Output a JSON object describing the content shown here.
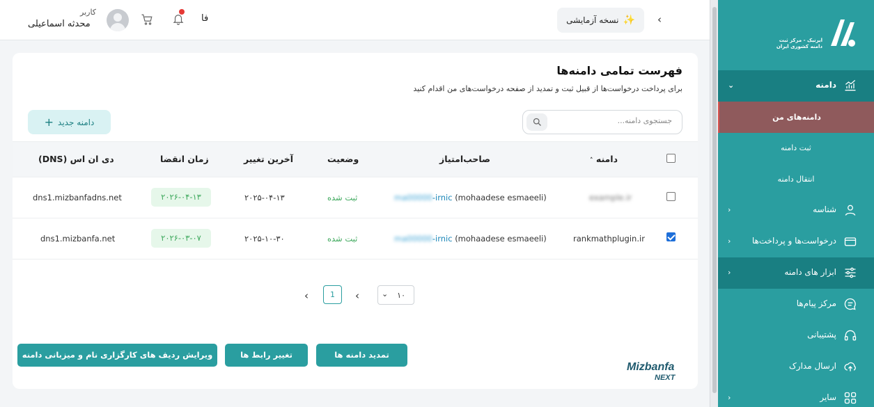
{
  "topbar": {
    "user_role": "کاربر",
    "user_name": "محدثه اسماعیلی",
    "language": "فا",
    "trial_label": "نسخه آزمایشی",
    "trial_icon": "sparkle-icon",
    "collapse_icon": "chevron-left-icon"
  },
  "sidebar": {
    "logo_text_line1": "ایرنیک - مرکز ثبت",
    "logo_text_line2": "دامنه کشوری ایران",
    "items": [
      {
        "label": "دامنه",
        "icon": "chart-icon",
        "expanded": true
      },
      {
        "label": "شناسه",
        "icon": "user-icon"
      },
      {
        "label": "درخواست‌ها و پرداخت‌ها",
        "icon": "card-icon"
      },
      {
        "label": "ابزار های دامنه",
        "icon": "sliders-icon"
      },
      {
        "label": "مرکز پیام‌ها",
        "icon": "message-icon"
      },
      {
        "label": "پشتیبانی",
        "icon": "headset-icon"
      },
      {
        "label": "ارسال مدارک",
        "icon": "upload-icon"
      },
      {
        "label": "سایر",
        "icon": "grid-icon"
      }
    ],
    "subitems": [
      {
        "label": "دامنه‌های من",
        "active": true
      },
      {
        "label": "ثبت دامنه"
      },
      {
        "label": "انتقال دامنه"
      }
    ]
  },
  "page": {
    "title": "فهرست تمامی دامنه‌ها",
    "subtitle": "برای پرداخت درخواست‌ها از قبیل ثبت و تمدید از صفحه درخواست‌های من اقدام کنید",
    "search_placeholder": "جستجوی دامنه...",
    "new_domain_label": "دامنه جدید"
  },
  "table": {
    "headers": {
      "domain": "دامنه",
      "owner": "صاحب‌امتیاز",
      "status": "وضعیت",
      "last_change": "آخرین تغییر",
      "expiry": "زمان انقضا",
      "dns": "دی ان اس (DNS)"
    },
    "rows": [
      {
        "checked": false,
        "domain": "example.ir",
        "owner_handle": "ma00000",
        "owner_suffix": "-irnic",
        "owner_name": "(mohaadese esmaeeli)",
        "status": "ثبت شده",
        "last_change": "۲۰۲۵-۰۴-۱۳",
        "expiry": "۲۰۲۶-۰۴-۱۳",
        "dns": "dns1.mizbanfadns.net"
      },
      {
        "checked": true,
        "domain": "rankmathplugin.ir",
        "owner_handle": "ma00000",
        "owner_suffix": "-irnic",
        "owner_name": "(mohaadese esmaeeli)",
        "status": "ثبت شده",
        "last_change": "۲۰۲۵-۱۰-۳۰",
        "expiry": "۲۰۲۶-۰۳-۰۷",
        "dns": "dns1.mizbanfa.net"
      }
    ]
  },
  "pagination": {
    "current_page": "1",
    "page_size": "۱۰"
  },
  "actions": {
    "renew": "تمدید دامنه ها",
    "change_contact": "تغییر رابط ها",
    "edit_ns": "ویرایش ردیف های کارگزاری نام و میزبانی دامنه"
  },
  "brand": {
    "name": "Mizbanfa",
    "tag": "NEXT",
    "color": "#1f5a6e"
  }
}
